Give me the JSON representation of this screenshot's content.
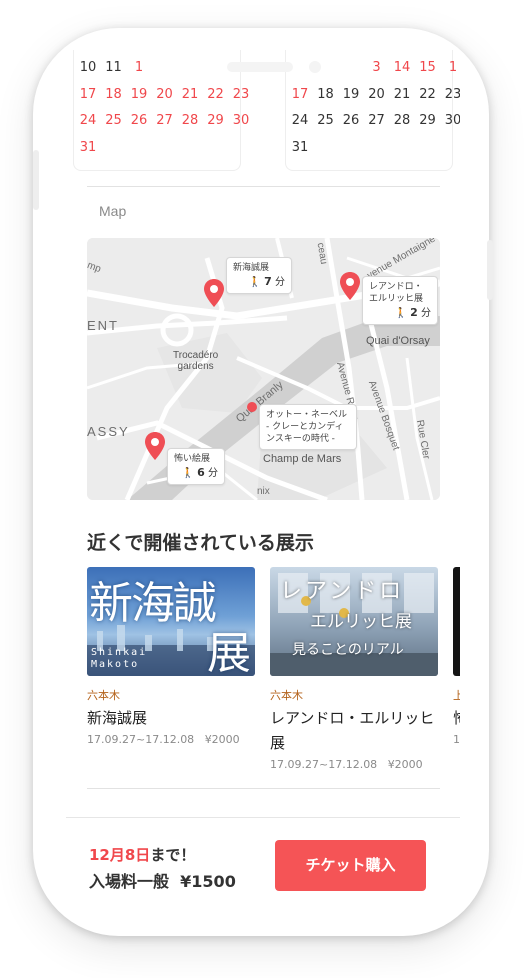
{
  "calendar": {
    "left": {
      "rows": [
        [
          {
            "d": "10",
            "red": false
          },
          {
            "d": "11",
            "red": false
          },
          {
            "d": "1",
            "red": true
          }
        ],
        [
          {
            "d": "17",
            "red": true
          },
          {
            "d": "18",
            "red": true
          },
          {
            "d": "19",
            "red": true
          },
          {
            "d": "20",
            "red": true
          },
          {
            "d": "21",
            "red": true
          },
          {
            "d": "22",
            "red": true
          },
          {
            "d": "23",
            "red": true
          }
        ],
        [
          {
            "d": "24",
            "red": true
          },
          {
            "d": "25",
            "red": true
          },
          {
            "d": "26",
            "red": true
          },
          {
            "d": "27",
            "red": true
          },
          {
            "d": "28",
            "red": true
          },
          {
            "d": "29",
            "red": true
          },
          {
            "d": "30",
            "red": true
          }
        ],
        [
          {
            "d": "31",
            "red": true
          }
        ]
      ]
    },
    "right": {
      "rows": [
        [
          {
            "d": "3",
            "red": true
          },
          {
            "d": "14",
            "red": true
          },
          {
            "d": "15",
            "red": true
          },
          {
            "d": "1",
            "red": true
          }
        ],
        [
          {
            "d": "17",
            "red": true
          },
          {
            "d": "18",
            "red": false
          },
          {
            "d": "19",
            "red": false
          },
          {
            "d": "20",
            "red": false
          },
          {
            "d": "21",
            "red": false
          },
          {
            "d": "22",
            "red": false
          },
          {
            "d": "23",
            "red": false
          }
        ],
        [
          {
            "d": "24",
            "red": false
          },
          {
            "d": "25",
            "red": false
          },
          {
            "d": "26",
            "red": false
          },
          {
            "d": "27",
            "red": false
          },
          {
            "d": "28",
            "red": false
          },
          {
            "d": "29",
            "red": false
          },
          {
            "d": "30",
            "red": false
          }
        ],
        [
          {
            "d": "31",
            "red": false
          }
        ]
      ]
    }
  },
  "map_section": {
    "label": "Map",
    "place_labels": {
      "mp": "mp",
      "ent": "ENT",
      "trocadero": "Trocadéro\ngardens",
      "assy": "ASSY",
      "quai_branly": "Quai Branly",
      "quai_orsay": "Quai d'Orsay",
      "avenue_rapp": "Avenue Rapp",
      "avenue_bosquet": "Avenue Bosquet",
      "rue_cler": "Rue Cler",
      "champ_de_mars": "Champ de Mars",
      "ceau": "ceau",
      "montaigne": "venue Montaigne",
      "m": "m",
      "nix": "nix"
    },
    "markers": [
      {
        "name": "新海誠展",
        "walk": "7",
        "unit": "分"
      },
      {
        "name": "レアンドロ・\nエルリッヒ展",
        "walk": "2",
        "unit": "分"
      },
      {
        "name": "怖い絵展",
        "walk": "6",
        "unit": "分"
      },
      {
        "name": "オットー・ネーベル\n- クレーとカンディ\nンスキーの時代 -",
        "walk": "",
        "unit": ""
      }
    ],
    "pin_color": "#ef4e55"
  },
  "nearby": {
    "heading": "近くで開催されている展示",
    "cards": [
      {
        "area": "六本木",
        "title": "新海誠展",
        "dates": "17.09.27~17.12.08",
        "price": "¥2000",
        "thumb_title": "新海誠",
        "thumb_sub": "展",
        "thumb_caption": "Shinkai Makoto"
      },
      {
        "area": "六本木",
        "title": "レアンドロ・エルリッヒ展",
        "dates": "17.09.27~17.12.08",
        "price": "¥2000",
        "thumb_title": "レアンドロ",
        "thumb_sub": "エルリッヒ展",
        "thumb_caption": "見ることのリアル"
      },
      {
        "area": "上",
        "title": "怖",
        "dates": "1",
        "price": ""
      }
    ]
  },
  "footer": {
    "deadline_date": "12月8日",
    "deadline_suffix": "まで！",
    "price_label": "入場料一般",
    "price": "¥1500",
    "buy_button": "チケット購入"
  },
  "colors": {
    "accent": "#f55456",
    "area": "#b4621a"
  }
}
